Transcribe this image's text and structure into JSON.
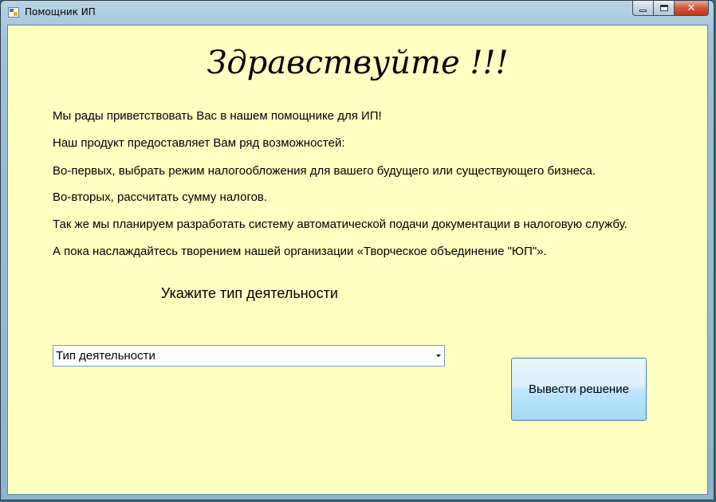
{
  "window": {
    "title": "Помощник ИП",
    "icon": "app-form-icon",
    "minimize_icon": "minimize-icon",
    "maximize_icon": "maximize-icon",
    "close_label": "✕"
  },
  "main": {
    "greeting": "Здравствуйте !!!",
    "paragraphs": [
      "Мы рады приветствовать Вас в нашем помощнике для ИП!",
      "Наш продукт предоставляет Вам ряд возможностей:",
      "Во-первых, выбрать режим налогообложения для вашего будущего или существующего бизнеса.",
      "Во-вторых, рассчитать сумму налогов.",
      "Так же мы планируем разработать систему автоматической подачи документации в налоговую службу.",
      "А пока наслаждайтесь творением нашей организации «Творческое объединение \"ЮП\"»."
    ],
    "prompt": "Укажите тип деятельности",
    "activity_select": {
      "value": "Тип деятельности",
      "arrow_icon": "dropdown-arrow-icon"
    },
    "action_button": "Вывести решение"
  },
  "colors": {
    "client_background": "#ffffc2",
    "button_gradient_top": "#eaf6fd",
    "button_gradient_bottom": "#a7d9f5",
    "button_border": "#3c7fb1",
    "close_button": "#c0391e"
  }
}
